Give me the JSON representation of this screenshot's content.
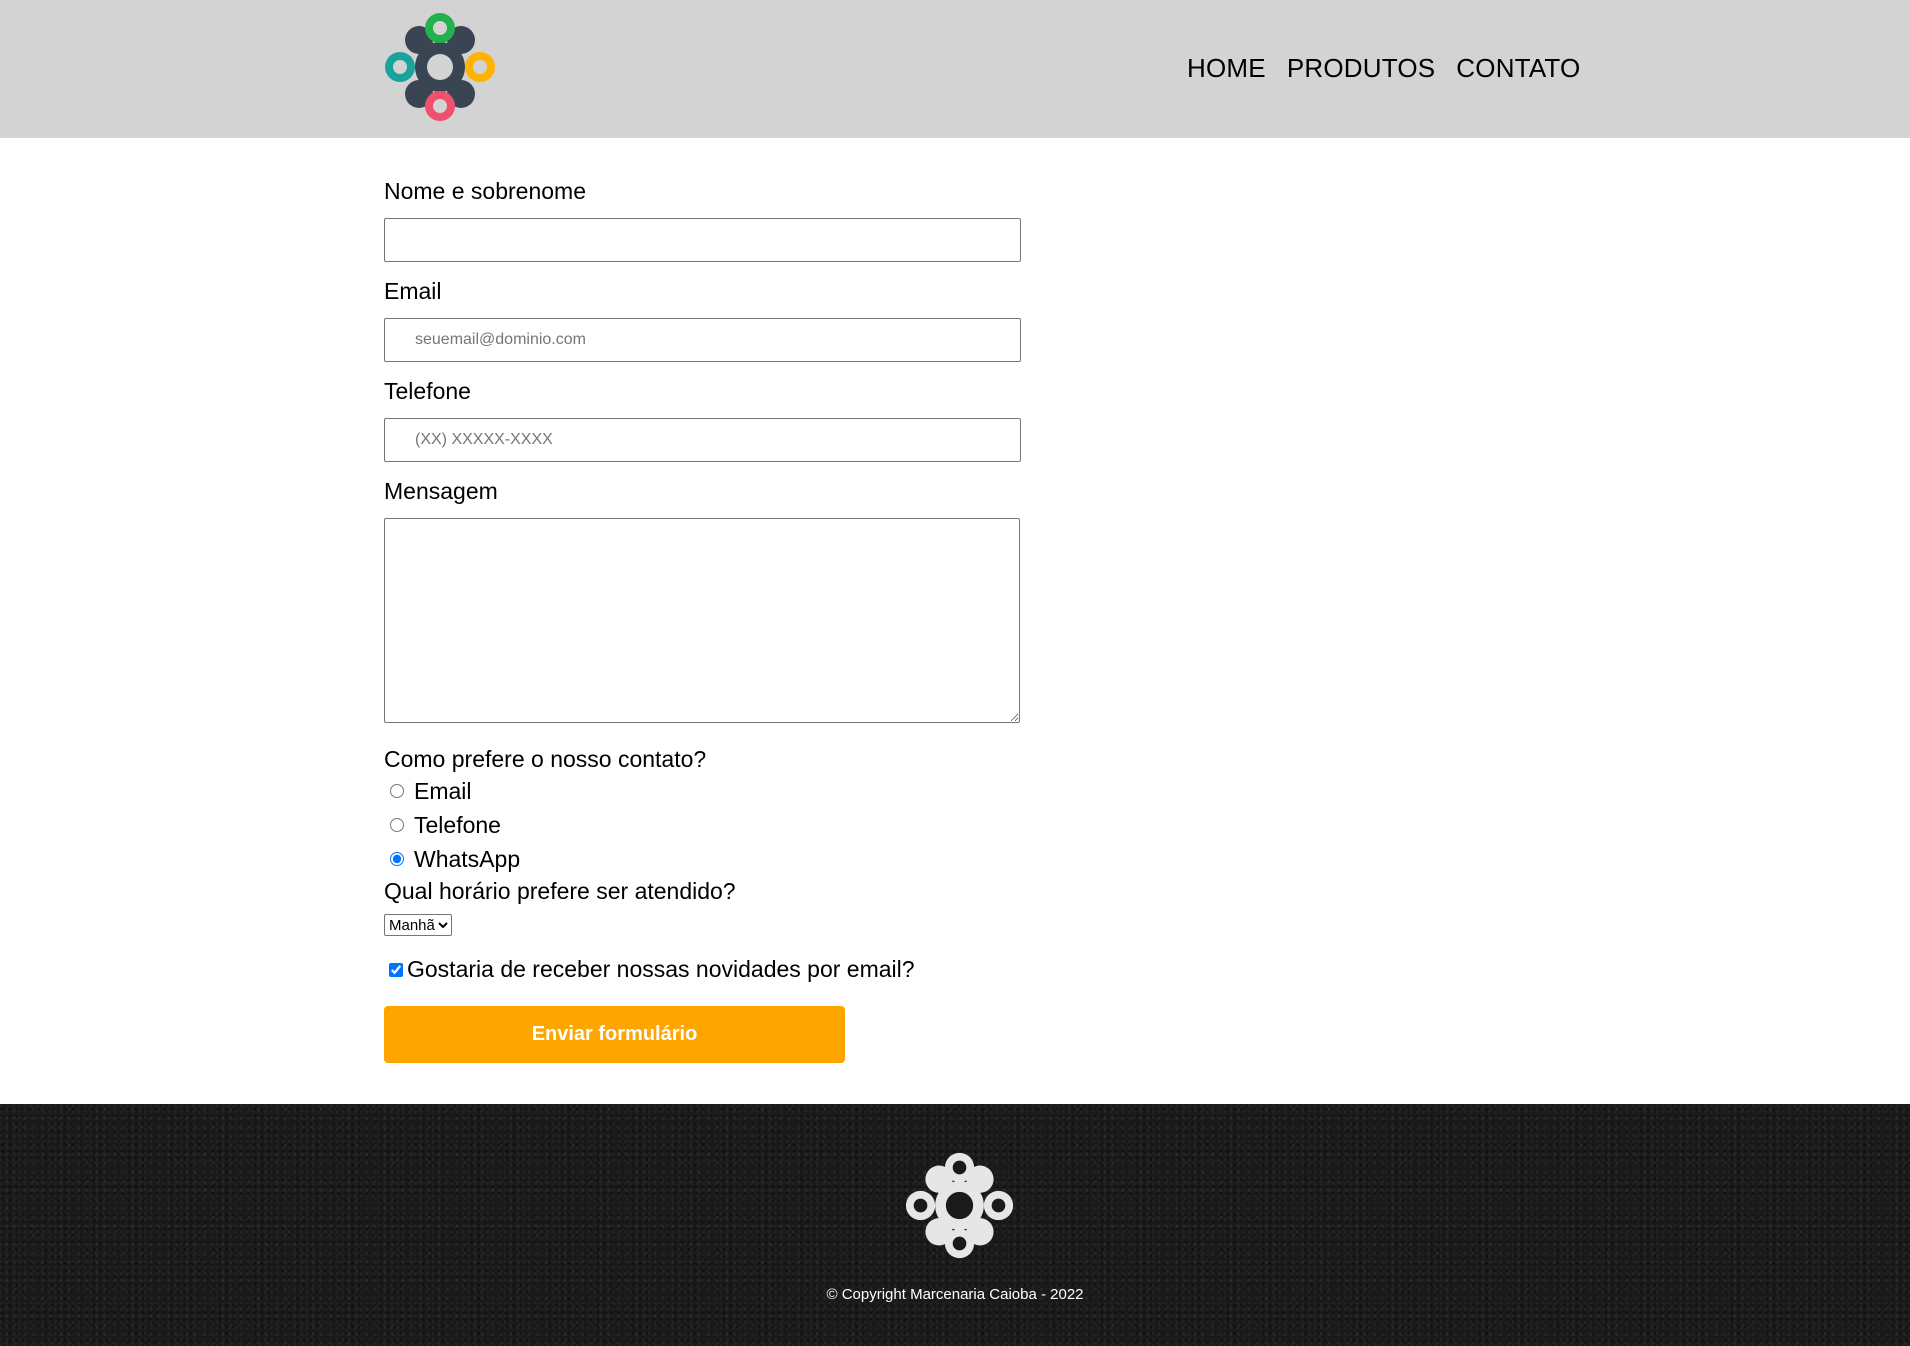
{
  "header": {
    "logo_icon": "colorful-circles-logo-icon",
    "nav": [
      {
        "label": "HOME"
      },
      {
        "label": "PRODUTOS"
      },
      {
        "label": "CONTATO"
      }
    ]
  },
  "form": {
    "name": {
      "label": "Nome e sobrenome",
      "value": "",
      "placeholder": ""
    },
    "email": {
      "label": "Email",
      "value": "",
      "placeholder": "seuemail@dominio.com"
    },
    "phone": {
      "label": "Telefone",
      "value": "",
      "placeholder": "(XX) XXXXX-XXXX"
    },
    "message": {
      "label": "Mensagem",
      "value": ""
    },
    "contact_pref": {
      "label": "Como prefere o nosso contato?",
      "options": [
        {
          "label": "Email",
          "checked": false
        },
        {
          "label": "Telefone",
          "checked": false
        },
        {
          "label": "WhatsApp",
          "checked": true
        }
      ]
    },
    "schedule": {
      "label": "Qual horário prefere ser atendido?",
      "selected": "Manhã"
    },
    "newsletter": {
      "label": "Gostaria de receber nossas novidades por email?",
      "checked": true
    },
    "submit_label": "Enviar formulário"
  },
  "footer": {
    "logo_icon": "white-circles-logo-icon",
    "copyright": "© Copyright Marcenaria Caioba - 2022"
  },
  "colors": {
    "header_bg": "#d3d3d3",
    "submit_bg": "#ffa500",
    "footer_bg": "#1a1a1a",
    "logo_green": "#22b14c",
    "logo_teal": "#1aa39a",
    "logo_orange": "#ffb200",
    "logo_pink": "#f0506e",
    "logo_dark": "#3a4554"
  }
}
